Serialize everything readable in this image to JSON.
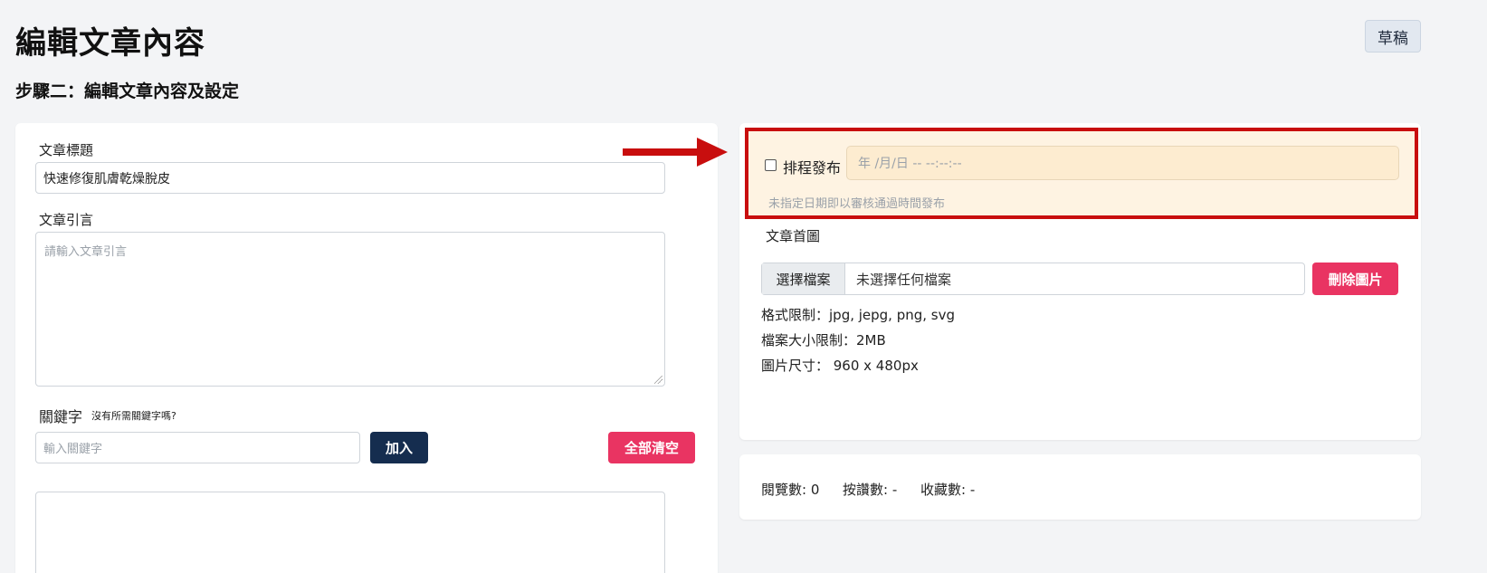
{
  "header": {
    "title": "編輯文章內容",
    "status_badge": "草稿",
    "step_title": "步驟二：編輯文章內容及設定"
  },
  "article": {
    "title_label": "文章標題",
    "title_value": "快速修復肌膚乾燥脫皮",
    "intro_label": "文章引言",
    "intro_placeholder": "請輸入文章引言",
    "keyword_label": "關鍵字",
    "keyword_help": "沒有所需關鍵字嗎?",
    "keyword_placeholder": "輸入關鍵字",
    "add_button": "加入",
    "clear_all_button": "全部清空"
  },
  "schedule": {
    "checkbox_label": "排程發布",
    "checked": false,
    "datetime_placeholder": "年 /月/日 -- --:--:--",
    "hint": "未指定日期即以審核通過時間發布"
  },
  "cover": {
    "label": "文章首圖",
    "choose_file_button": "選擇檔案",
    "no_file_text": "未選擇任何檔案",
    "delete_button": "刪除圖片",
    "format_limit": "格式限制：jpg, jepg, png, svg",
    "size_limit": "檔案大小限制：2MB",
    "dimensions": "圖片尺寸： 960 x 480px"
  },
  "stats": {
    "views": "閱覽數: 0",
    "likes": "按讚數: -",
    "bookmarks": "收藏數: -"
  },
  "colors": {
    "highlight_border": "#c80e0e",
    "navy_button": "#152d4f",
    "pink_button": "#e93462",
    "schedule_bg": "#fef3e2"
  }
}
